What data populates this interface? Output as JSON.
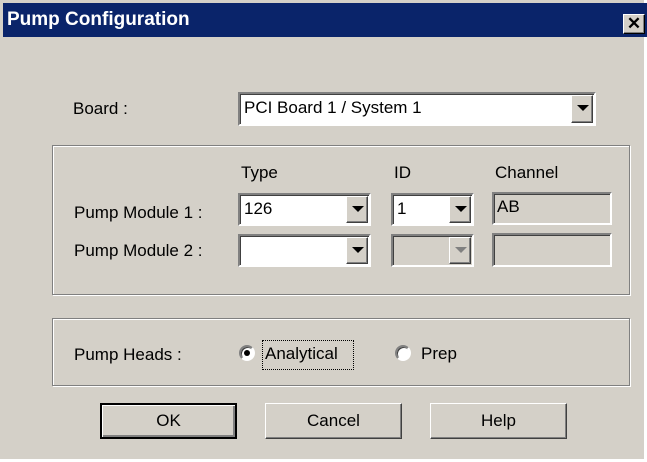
{
  "window": {
    "title": "Pump Configuration",
    "close_label": "✕"
  },
  "board": {
    "label": "Board :",
    "value": "PCI Board 1 / System 1"
  },
  "modules": {
    "headers": {
      "type": "Type",
      "id": "ID",
      "channel": "Channel"
    },
    "rows": [
      {
        "label": "Pump Module 1 :",
        "type": "126",
        "id": "1",
        "channel": "AB"
      },
      {
        "label": "Pump Module 2 :",
        "type": "",
        "id": "",
        "channel": ""
      }
    ]
  },
  "pump_heads": {
    "label": "Pump Heads :",
    "options": [
      {
        "label": "Analytical",
        "selected": true
      },
      {
        "label": "Prep",
        "selected": false
      }
    ]
  },
  "buttons": {
    "ok": "OK",
    "cancel": "Cancel",
    "help": "Help"
  }
}
